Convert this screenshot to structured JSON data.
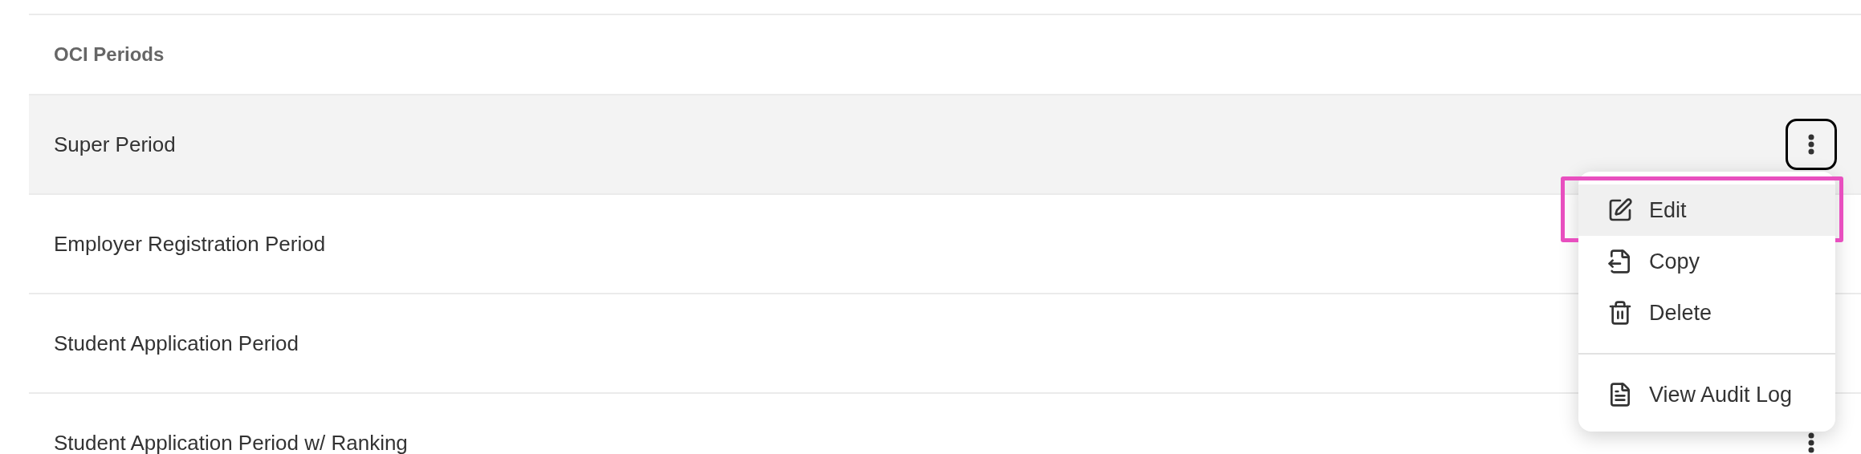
{
  "list": {
    "title": "OCI Periods",
    "rows": [
      {
        "label": "Super Period",
        "selected": true,
        "action_button": true,
        "focused": true
      },
      {
        "label": "Employer Registration Period",
        "selected": false,
        "action_button": false
      },
      {
        "label": "Student Application Period",
        "selected": false,
        "action_button": false
      },
      {
        "label": "Student Application Period w/ Ranking",
        "selected": false,
        "action_button": true,
        "focused": false
      }
    ]
  },
  "menu": {
    "groups": [
      [
        {
          "label": "Edit",
          "kind": "edit",
          "selected": true
        },
        {
          "label": "Copy",
          "kind": "copy",
          "selected": false
        },
        {
          "label": "Delete",
          "kind": "delete",
          "selected": false
        }
      ],
      [
        {
          "label": "View Audit Log",
          "kind": "log",
          "selected": false
        }
      ]
    ]
  }
}
